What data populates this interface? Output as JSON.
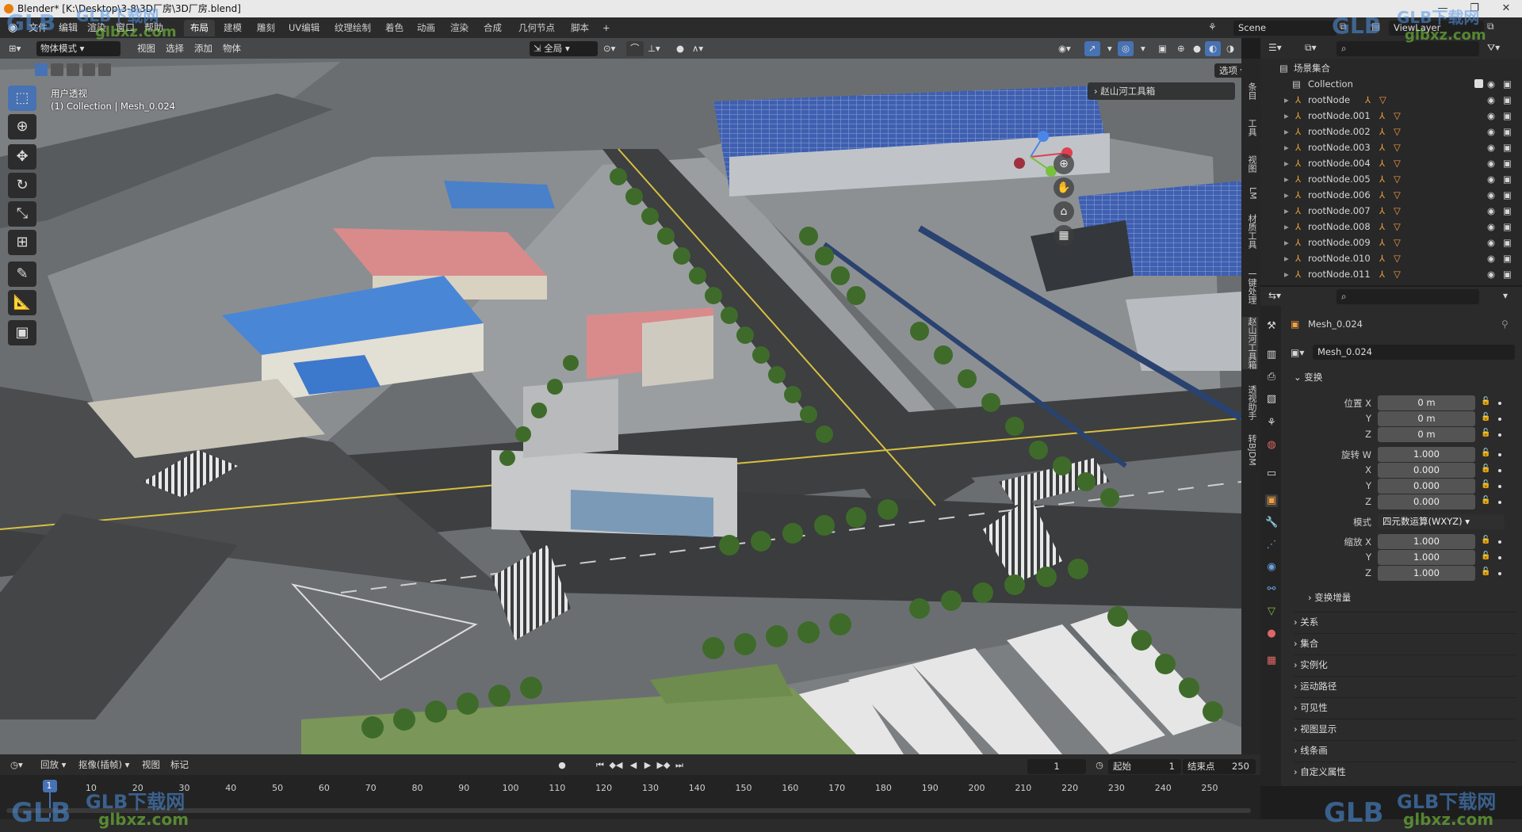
{
  "window": {
    "title": "Blender* [K:\\Desktop\\3-8\\3D厂房\\3D厂房.blend]",
    "min_label": "—",
    "max_label": "❐",
    "close_label": "✕"
  },
  "menu": {
    "items": [
      "文件",
      "编辑",
      "渲染",
      "窗口",
      "帮助"
    ]
  },
  "workspaces": [
    "布局",
    "建模",
    "雕刻",
    "UV编辑",
    "纹理绘制",
    "着色",
    "动画",
    "渲染",
    "合成",
    "几何节点",
    "脚本",
    "+"
  ],
  "scene": {
    "name": "Scene",
    "view_layer": "ViewLayer"
  },
  "viewport": {
    "mode": "物体模式",
    "menu": [
      "视图",
      "选择",
      "添加",
      "物体"
    ],
    "transform_orientation": "全局",
    "view_name": "用户透视",
    "collection_info": "(1) Collection | Mesh_0.024",
    "options_label": "选项",
    "toolbox_label": "赵山河工具箱",
    "sidebar_tabs": [
      "条目",
      "工具",
      "视图",
      "LM",
      "材质工具",
      "一键处理",
      "赵山河工具箱",
      "透视助手",
      "转BJDM"
    ]
  },
  "outliner": {
    "root": "场景集合",
    "collection": "Collection",
    "nodes": [
      "rootNode",
      "rootNode.001",
      "rootNode.002",
      "rootNode.003",
      "rootNode.004",
      "rootNode.005",
      "rootNode.006",
      "rootNode.007",
      "rootNode.008",
      "rootNode.009",
      "rootNode.010",
      "rootNode.011"
    ]
  },
  "properties": {
    "object_name": "Mesh_0.024",
    "data_name": "Mesh_0.024",
    "transform_label": "变换",
    "location_label": "位置 X",
    "location": [
      "0 m",
      "0 m",
      "0 m"
    ],
    "rotation_label": "旋转 W",
    "rotation": [
      "1.000",
      "0.000",
      "0.000",
      "0.000"
    ],
    "mode_label": "模式",
    "mode_value": "四元数运算(WXYZ)",
    "scale_label": "缩放 X",
    "scale": [
      "1.000",
      "1.000",
      "1.000"
    ],
    "axis_labels": [
      "Y",
      "Z",
      "X"
    ],
    "delta_label": "变换增量",
    "sections": [
      "关系",
      "集合",
      "实例化",
      "运动路径",
      "可见性",
      "视图显示",
      "线条画",
      "自定义属性"
    ]
  },
  "timeline": {
    "menu": [
      "回放",
      "抠像(插帧)",
      "视图",
      "标记"
    ],
    "current_frame": "1",
    "start_label": "起始",
    "start": "1",
    "end_label": "结束点",
    "end": "250",
    "ticks": [
      "1",
      "10",
      "20",
      "30",
      "40",
      "50",
      "60",
      "70",
      "80",
      "90",
      "100",
      "110",
      "120",
      "130",
      "140",
      "150",
      "160",
      "170",
      "180",
      "190",
      "200",
      "210",
      "220",
      "230",
      "240",
      "250"
    ]
  },
  "watermark": {
    "brand": "GLB",
    "cn": "GLB下载网",
    "url": "glbxz.com"
  }
}
